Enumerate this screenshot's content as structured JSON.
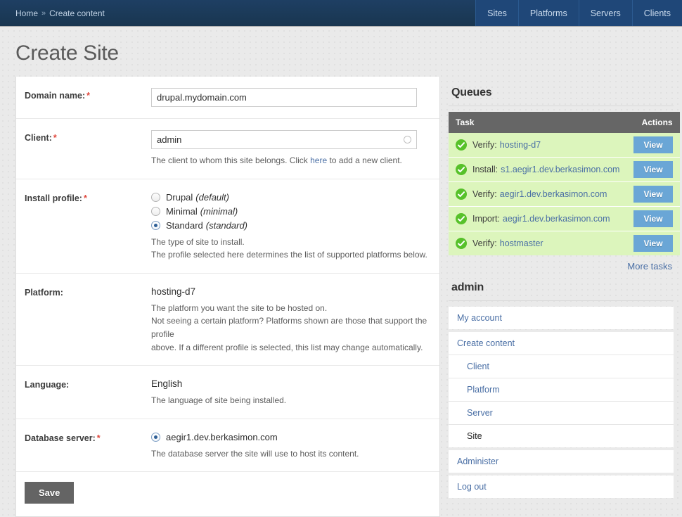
{
  "topbar": {
    "breadcrumb": [
      {
        "label": "Home",
        "link": true
      },
      {
        "label": "Create content",
        "link": true
      }
    ],
    "separator": "»",
    "nav": [
      {
        "label": "Sites"
      },
      {
        "label": "Platforms"
      },
      {
        "label": "Servers"
      },
      {
        "label": "Clients"
      }
    ]
  },
  "page": {
    "title": "Create Site"
  },
  "form": {
    "required_marker": "*",
    "domain": {
      "label": "Domain name:",
      "required": true,
      "value": "drupal.mydomain.com",
      "placeholder": ""
    },
    "client": {
      "label": "Client:",
      "required": true,
      "value": "admin",
      "placeholder": "",
      "description_before": "The client to whom this site belongs. Click ",
      "description_link": "here",
      "description_after": " to add a new client."
    },
    "install_profile": {
      "label": "Install profile:",
      "required": true,
      "options": [
        {
          "name": "Drupal",
          "machine": "(default)",
          "selected": false
        },
        {
          "name": "Minimal",
          "machine": "(minimal)",
          "selected": false
        },
        {
          "name": "Standard",
          "machine": "(standard)",
          "selected": true
        }
      ],
      "description_line1": "The type of site to install.",
      "description_line2": "The profile selected here determines the list of supported platforms below."
    },
    "platform": {
      "label": "Platform:",
      "required": false,
      "value": "hosting-d7",
      "description_line1": "The platform you want the site to be hosted on.",
      "description_line2": "Not seeing a certain platform? Platforms shown are those that support the profile",
      "description_line3": "above. If a different profile is selected, this list may change automatically."
    },
    "language": {
      "label": "Language:",
      "required": false,
      "value": "English",
      "description": "The language of site being installed."
    },
    "database_server": {
      "label": "Database server:",
      "required": true,
      "options": [
        {
          "name": "aegir1.dev.berkasimon.com",
          "selected": true
        }
      ],
      "description": "The database server the site will use to host its content."
    },
    "save_label": "Save"
  },
  "sidebar": {
    "queues": {
      "title": "Queues",
      "columns": {
        "task": "Task",
        "actions": "Actions"
      },
      "view_label": "View",
      "status_icon": "check-circle-icon",
      "rows": [
        {
          "op": "Verify:",
          "target": "hosting-d7"
        },
        {
          "op": "Install:",
          "target": "s1.aegir1.dev.berkasimon.com"
        },
        {
          "op": "Verify:",
          "target": "aegir1.dev.berkasimon.com"
        },
        {
          "op": "Import:",
          "target": "aegir1.dev.berkasimon.com"
        },
        {
          "op": "Verify:",
          "target": "hostmaster"
        }
      ],
      "more_label": "More tasks"
    },
    "user_menu": {
      "title": "admin",
      "items": [
        {
          "label": "My account",
          "active": false,
          "children": []
        },
        {
          "label": "Create content",
          "active": false,
          "children": [
            {
              "label": "Client",
              "active": false
            },
            {
              "label": "Platform",
              "active": false
            },
            {
              "label": "Server",
              "active": false
            },
            {
              "label": "Site",
              "active": true
            }
          ]
        },
        {
          "label": "Administer",
          "active": false,
          "children": []
        },
        {
          "label": "Log out",
          "active": false,
          "children": []
        }
      ]
    }
  },
  "colors": {
    "topbar": "#1b3a5c",
    "nav_tab": "#1f4778",
    "link": "#4a6fa5",
    "required": "#e04a3f",
    "queue_row": "#dcf5bc",
    "queue_header": "#666666",
    "check_green": "#57c12a",
    "view_button": "#6aa6d6",
    "save_button": "#646464"
  }
}
